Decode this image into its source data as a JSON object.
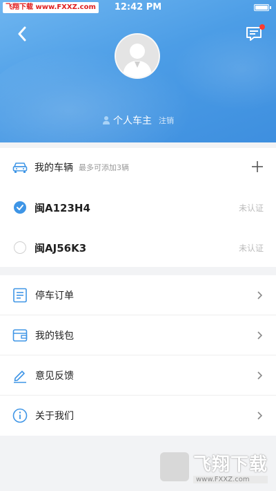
{
  "status_bar": {
    "site_label": "飞翔下载 www.FXXZ.com",
    "time": "12:42 PM"
  },
  "profile": {
    "owner_label": "个人车主",
    "logout_label": "注销",
    "avatar_icon": "user-avatar-icon"
  },
  "vehicles": {
    "title": "我的车辆",
    "hint": "最多可添加3辆",
    "items": [
      {
        "plate": "闽A123H4",
        "status": "未认证",
        "selected": true
      },
      {
        "plate": "闽AJ56K3",
        "status": "未认证",
        "selected": false
      }
    ]
  },
  "menu": {
    "items": [
      {
        "label": "停车订单",
        "icon": "order-list-icon"
      },
      {
        "label": "我的钱包",
        "icon": "wallet-icon"
      },
      {
        "label": "意见反馈",
        "icon": "pencil-icon"
      },
      {
        "label": "关于我们",
        "icon": "info-icon"
      }
    ]
  },
  "watermark": {
    "title": "飞翔下载",
    "url": "www.FXXZ.com"
  },
  "colors": {
    "accent": "#3e95e6",
    "header_gradient_start": "#6fb6f0",
    "header_gradient_end": "#3e8fdf",
    "notification_dot": "#ff3b30"
  }
}
